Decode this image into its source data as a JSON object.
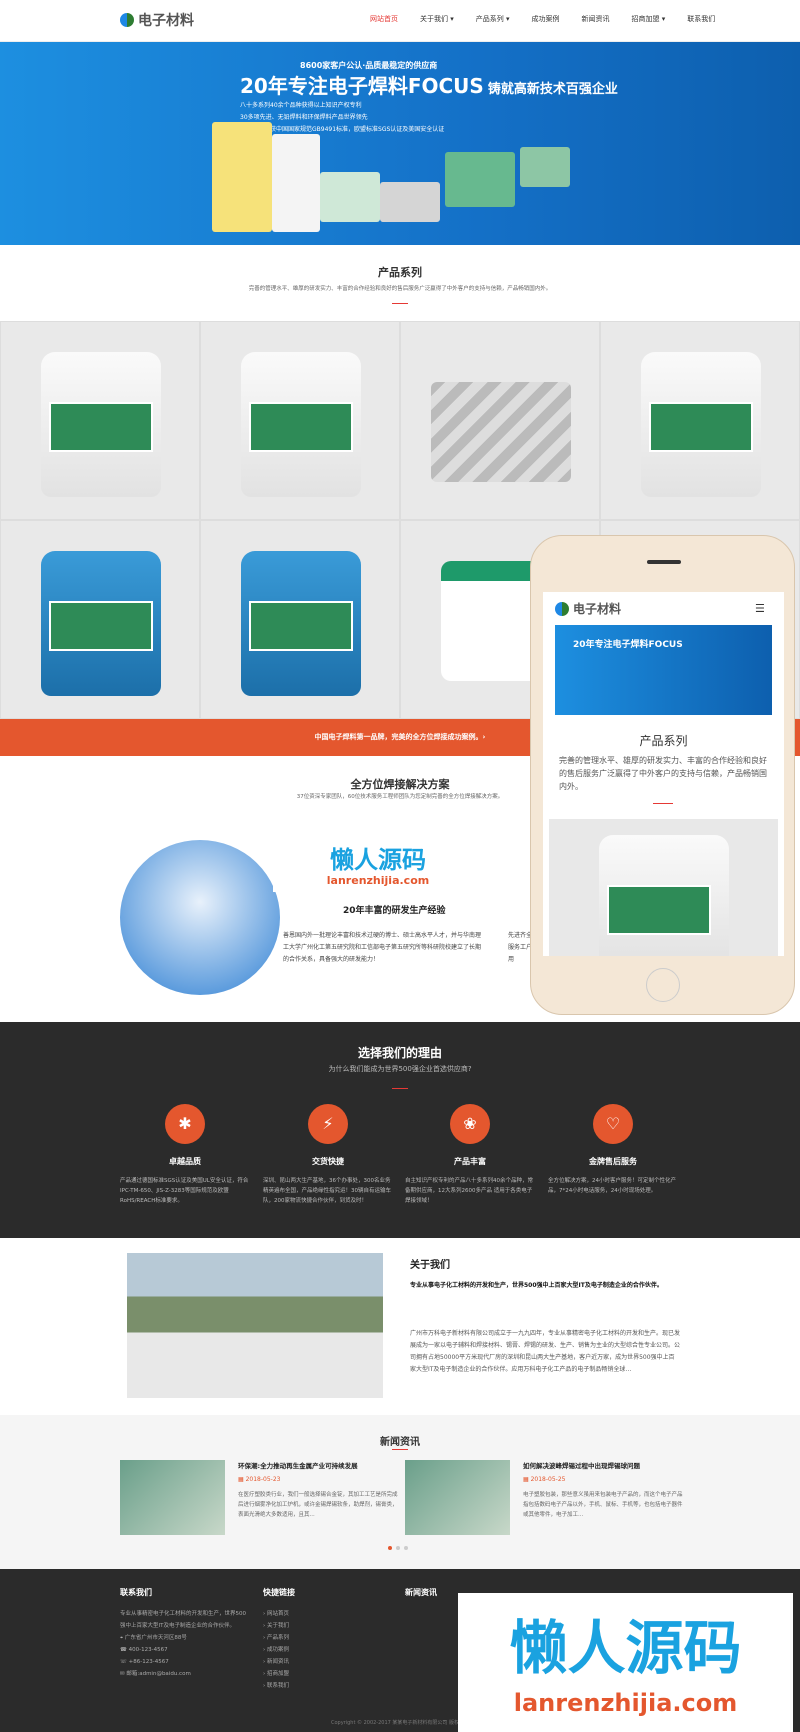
{
  "nav": {
    "logo_text": "电子材料",
    "items": [
      "网站首页",
      "关于我们",
      "产品系列",
      "成功案例",
      "新闻资讯",
      "招商加盟",
      "联系我们"
    ]
  },
  "hero": {
    "subtitle": "8600家客户公认·品质最稳定的供应商",
    "title": "20年专注电子焊料FOCUS",
    "title_tail": "铸就高新技术百强企业",
    "points": [
      "八十多系列40余个品种获得以上知识产权专利",
      "30多项先进、无铅焊料和环保焊料产品世界领先",
      "所有产品均获中国国家规范GB9491标准，欧盟标准SGS认证及美国安全认证"
    ]
  },
  "products": {
    "title": "产品系列",
    "desc": "完善的管理水平、雄厚的研发实力、丰富的合作经验和良好的售后服务广泛赢得了中外客户的支持与信赖，产品畅销国内外。"
  },
  "banner": {
    "text": "中国电子焊料第一品牌，完美的全方位焊接成功案例。›"
  },
  "solution": {
    "title": "全方位焊接解决方案",
    "desc": "37位资深专家团队，60位技术服务工程师团队为您定制完善的全方位焊接解决方案。",
    "exp_title": "20年丰富的研发生产经验",
    "exp_text": "善恩国内外一批理论丰富和技术过硬的博士、硕士高水平人才，并与华南理工大学广州化工第五研究院和工信部电子第五研究所等科研院校建立了长期的合作关系，具备强大的研发能力！",
    "exp_text2": "先进齐全的服务工户使用"
  },
  "phone": {
    "logo_text": "电子材料",
    "menu_icon": "☰",
    "hero_text": "20年专注电子焊料FOCUS",
    "title": "产品系列",
    "desc": "完善的管理水平、雄厚的研发实力、丰富的合作经验和良好的售后服务广泛赢得了中外客户的支持与信赖，产品畅销国内外。"
  },
  "why": {
    "title": "选择我们的理由",
    "subtitle": "为什么我们能成为世界500强企业首选供应商?",
    "features": [
      {
        "icon": "✱",
        "name": "卓越品质",
        "desc": "产品通过德国标准SGS认证及美国UL安全认证，符合IPC-TM-650、JIS-Z-3283等国际规范及欧盟RoHS/REACH标准要求。"
      },
      {
        "icon": "⚡",
        "name": "交货快捷",
        "desc": "深圳、昆山两大生产基地，36个办事处，300名业务精英遍布全国，产品绝缘性指究运！30辆自有运输车队，200家物流快捷合作伙伴，到货及时！"
      },
      {
        "icon": "❀",
        "name": "产品丰富",
        "desc": "自主知识产权专利的产品八十多系列40余个品种，常备期供应商，12大系列2600多产品 适用于各类电子焊接领域！"
      },
      {
        "icon": "♡",
        "name": "金牌售后服务",
        "desc": "全方位解决方案，24小时客户服务！可定制个性化产品，7*24小时电话服务，24小时现场处理。"
      }
    ]
  },
  "about": {
    "title": "关于我们",
    "bold_text": "专业从事电子化工材料的开发和生产，世界500强中上百家大型IT及电子制造企业的合作伙伴。",
    "text": "广州市万科电子新材料有限公司成立于一九九四年，专业从事精密电子化工材料的开发和生产。现已发展成为一家以电子辅料和焊接材料、锡膏、焊锡的研发、生产、销售为主业的大型综合性专业公司。公司拥有占地50000平方米现代厂房的深圳和昆山两大生产基地，客户近万家，成为世界500强中上百家大型IT及电子制造企业的合作伙伴。应用万科电子化工产品的电子制品畅销全球…"
  },
  "news": {
    "title": "新闻资讯",
    "items": [
      {
        "title": "环保潮:全力推动再生金属产业可持续发展",
        "date": "2018-05-23",
        "text": "在医疗塑胶类行业，我们一般选择锡合金锭，其加工工艺是所完成后进行烟雾净化加工炉机，或许金锡焊锡软条，助焊剂，锡膏类，表面光滑绝大多数适用，且其..."
      },
      {
        "title": "如何解决波峰焊锡过程中出现焊锡球问题",
        "date": "2018-05-25",
        "text": "电子塑胶包装，那些意义虽用来包装电子产品的，而这个电子产品指包括数码电子产品以外，手机、鼠标、手机等，也包括电子器件或其他零件，电子加工..."
      }
    ]
  },
  "footer": {
    "cols": [
      {
        "title": "联系我们",
        "lines": [
          "专业从事精密电子化工材料的开发和生产，世界500强中上百家大型IT及电子制造企业的合作伙伴。",
          "广东省广州市天河区88号",
          "400-123-4567",
          "+86-123-4567",
          "邮箱:admin@baidu.com"
        ]
      },
      {
        "title": "快捷链接",
        "lines": [
          "网站首页",
          "关于我们",
          "产品系列",
          "成功案例",
          "新闻资讯",
          "招商加盟",
          "联系我们"
        ]
      },
      {
        "title": "新闻资讯",
        "lines": []
      }
    ],
    "copyright": "Copyright © 2002-2017 某某电子新材料有限公司 版权所有"
  },
  "watermark": {
    "cn": "懒人源码",
    "en": "lanrenzhijia.com"
  },
  "colors": {
    "accent": "#e4572e",
    "hero_blue": "#1470c7",
    "dark": "#2b2b2b"
  }
}
